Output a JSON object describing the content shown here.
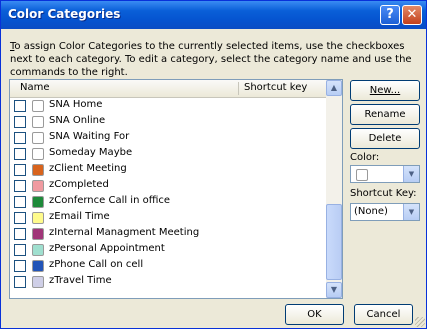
{
  "window": {
    "title": "Color Categories",
    "help_glyph": "?",
    "close_glyph": "✕"
  },
  "intro": {
    "first_letter": "T",
    "rest": "o assign Color Categories to the currently selected items, use the checkboxes next to each category.  To edit a category, select the category name and use the commands to the right."
  },
  "list": {
    "header_name": "Name",
    "header_shortcut": "Shortcut key",
    "items": [
      {
        "label": "SNA Home",
        "color": "#ffffff"
      },
      {
        "label": "SNA Online",
        "color": "#ffffff"
      },
      {
        "label": "SNA Waiting For",
        "color": "#ffffff"
      },
      {
        "label": "Someday Maybe",
        "color": "#ffffff"
      },
      {
        "label": "zClient Meeting",
        "color": "#d8631c"
      },
      {
        "label": "zCompleted",
        "color": "#f09aa0"
      },
      {
        "label": "zConfernce Call in office",
        "color": "#1e8a3a"
      },
      {
        "label": "zEmail Time",
        "color": "#fffb8c"
      },
      {
        "label": "zInternal Managment Meeting",
        "color": "#a03578"
      },
      {
        "label": "zPersonal Appointment",
        "color": "#9fdfcf"
      },
      {
        "label": "zPhone Call on cell",
        "color": "#2154b8"
      },
      {
        "label": "zTravel Time",
        "color": "#cfcfe7"
      }
    ]
  },
  "actions": {
    "new_label": "New...",
    "rename_label": "Rename",
    "delete_label": "Delete",
    "color_label": "Color:",
    "shortcut_label": "Shortcut Key:",
    "shortcut_value": "(None)"
  },
  "footer": {
    "ok_label": "OK",
    "cancel_label": "Cancel"
  }
}
